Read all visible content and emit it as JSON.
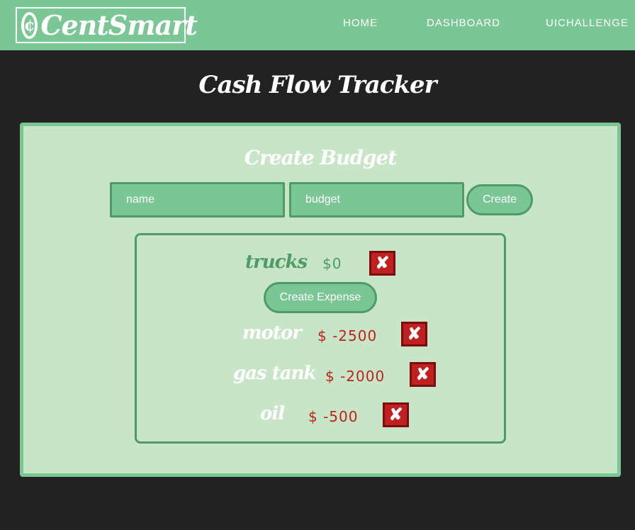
{
  "nav": {
    "brand_symbol": "¢",
    "brand_name": "CentSmart",
    "links": [
      "HOME",
      "DASHBOARD",
      "UICHALLENGE"
    ]
  },
  "page_title": "Cash Flow Tracker",
  "create_budget": {
    "title": "Create Budget",
    "name_placeholder": "name",
    "budget_placeholder": "budget",
    "create_label": "Create"
  },
  "budget": {
    "name": "trucks",
    "amount": "$0",
    "delete_symbol": "✘",
    "create_expense_label": "Create Expense",
    "expenses": [
      {
        "name": "motor",
        "amount": "$ -2500"
      },
      {
        "name": "gas tank",
        "amount": "$ -2000"
      },
      {
        "name": "oil",
        "amount": "$ -500"
      }
    ]
  },
  "colors": {
    "nav_green": "#7ac695",
    "panel_green": "#c8e6c7",
    "border_green": "#4e9a68",
    "expense_red": "#c0201f",
    "background": "#222222"
  }
}
